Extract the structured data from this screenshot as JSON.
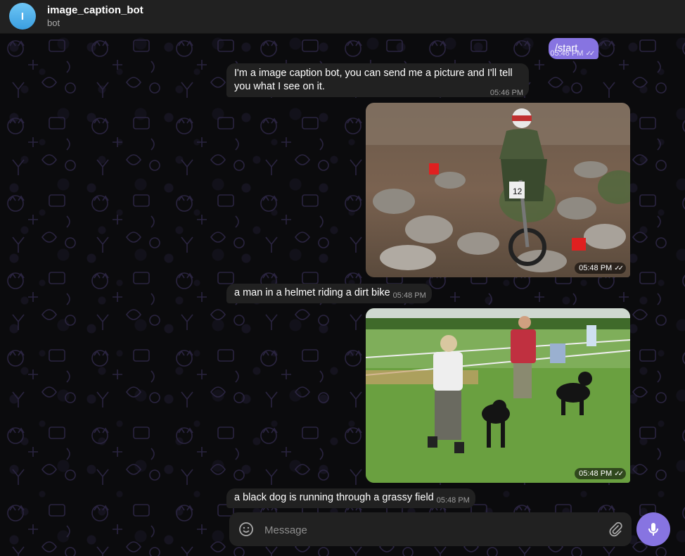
{
  "header": {
    "avatar_letter": "I",
    "title": "image_caption_bot",
    "subtitle": "bot"
  },
  "messages": [
    {
      "text": "/start",
      "time": "05:46 PM",
      "status": "read"
    },
    {
      "text": "I'm a image caption bot, you can send me a picture and I'll tell you what I see on it.",
      "time": "05:46 PM"
    },
    {
      "type": "photo",
      "time": "05:48 PM",
      "status": "read"
    },
    {
      "text": "a man in a helmet riding a dirt bike",
      "time": "05:48 PM"
    },
    {
      "type": "photo",
      "time": "05:48 PM",
      "status": "read"
    },
    {
      "text": "a black dog is running through a grassy field",
      "time": "05:48 PM"
    }
  ],
  "composer": {
    "placeholder": "Message"
  },
  "icons": {
    "emoji": "emoji-icon",
    "attach": "paperclip-icon",
    "mic": "microphone-icon",
    "read": "double-check-icon"
  },
  "colors": {
    "accent": "#8774e1",
    "bubble_in": "#212121",
    "header_bg": "#212121",
    "avatar": "#3a9ee0"
  }
}
